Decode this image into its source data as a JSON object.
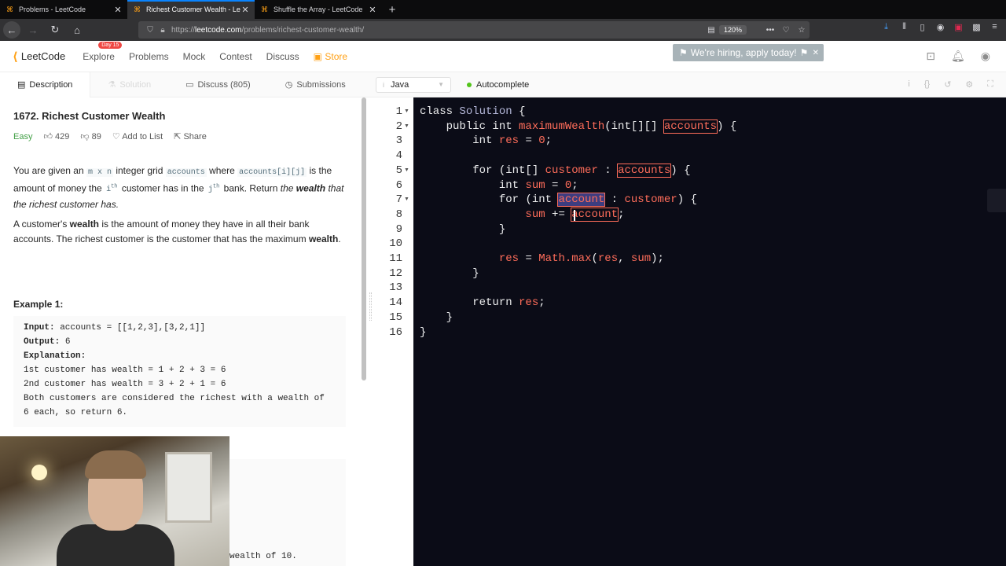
{
  "browser": {
    "tabs": [
      {
        "title": "Problems - LeetCode",
        "active": false
      },
      {
        "title": "Richest Customer Wealth - Lee",
        "active": true
      },
      {
        "title": "Shuffle the Array - LeetCode",
        "active": false
      }
    ],
    "url_prefix": "https://",
    "url_domain": "leetcode.com",
    "url_path": "/problems/richest-customer-wealth/",
    "zoom": "120%"
  },
  "lcnav": {
    "logo": "LeetCode",
    "items": [
      "Explore",
      "Problems",
      "Mock",
      "Contest",
      "Discuss"
    ],
    "explore_badge": "Day 15",
    "store": "Store",
    "hiring": "We're hiring, apply today!"
  },
  "left_tabs": {
    "description": "Description",
    "solution": "Solution",
    "discuss": "Discuss (805)",
    "submissions": "Submissions"
  },
  "problem": {
    "title": "1672. Richest Customer Wealth",
    "difficulty": "Easy",
    "likes": "429",
    "dislikes": "89",
    "add_to_list": "Add to List",
    "share": "Share",
    "p1_a": "You are given an",
    "p1_code1": "m x n",
    "p1_b": "integer grid",
    "p1_code2": "accounts",
    "p1_c": "where",
    "p1_code3": "accounts[i][j]",
    "p1_d": "is the amount of money the",
    "p1_i": "i",
    "p1_th1": "th",
    "p1_e": "customer has in the",
    "p1_j": "j",
    "p1_th2": "th",
    "p1_f": "bank. Return",
    "p1_g": "the",
    "p1_h_bold": "wealth",
    "p1_h": "that the richest customer has.",
    "p2_a": "A customer's",
    "p2_bold": "wealth",
    "p2_b": "is the amount of money they have in all their bank accounts. The richest customer is the customer that has the maximum",
    "p2_bold2": "wealth",
    "p2_c": ".",
    "example_title": "Example 1:",
    "example_lines": [
      {
        "label": "Input:",
        "text": " accounts = [[1,2,3],[3,2,1]]"
      },
      {
        "label": "Output:",
        "text": " 6"
      },
      {
        "label": "Explanation:",
        "text": ""
      },
      {
        "label": "",
        "text": "1st customer has wealth = 1 + 2 + 3 = 6"
      },
      {
        "label": "",
        "text": "2nd customer has wealth = 3 + 2 + 1 = 6"
      },
      {
        "label": "",
        "text": "Both customers are considered the richest with a wealth of"
      },
      {
        "label": "",
        "text": "6 each, so return 6."
      }
    ],
    "example2_tail": "wealth of 10."
  },
  "editor_toolbar": {
    "language": "Java",
    "autocomplete": "Autocomplete"
  },
  "code": {
    "line_numbers": [
      "1",
      "2",
      "3",
      "4",
      "5",
      "6",
      "7",
      "8",
      "9",
      "10",
      "11",
      "12",
      "13",
      "14",
      "15",
      "16"
    ],
    "l1_kw": "class",
    "l1_cls": "Solution",
    "l1_end": " {",
    "l2_ind": "    ",
    "l2_kw": "public int ",
    "l2_fn": "maximumWealth",
    "l2_mid": "(int[][] ",
    "l2_arg": "accounts",
    "l2_end": ") {",
    "l3_ind": "        ",
    "l3_kw": "int ",
    "l3_var": "res",
    "l3_mid": " = ",
    "l3_num": "0",
    "l3_end": ";",
    "l5_ind": "        ",
    "l5_kw": "for ",
    "l5_a": "(int[] ",
    "l5_var": "customer",
    "l5_b": " : ",
    "l5_arg": "accounts",
    "l5_end": ") {",
    "l6_ind": "            ",
    "l6_kw": "int ",
    "l6_var": "sum",
    "l6_mid": " = ",
    "l6_num": "0",
    "l6_end": ";",
    "l7_ind": "            ",
    "l7_kw": "for ",
    "l7_a": "(int ",
    "l7_var": "account",
    "l7_b": " : ",
    "l7_c": "customer",
    "l7_end": ") {",
    "l8_ind": "                ",
    "l8_var": "sum",
    "l8_mid": " += ",
    "l8_arg": "account",
    "l8_end": ";",
    "l9_ind": "            ",
    "l9_end": "}",
    "l11_ind": "            ",
    "l11_var": "res",
    "l11_mid": " = ",
    "l11_fn": "Math.max",
    "l11_a": "(",
    "l11_v1": "res",
    "l11_b": ", ",
    "l11_v2": "sum",
    "l11_end": ");",
    "l12_ind": "        ",
    "l12_end": "}",
    "l14_ind": "        ",
    "l14_kw": "return ",
    "l14_var": "res",
    "l14_end": ";",
    "l15_ind": "    ",
    "l15_end": "}",
    "l16_end": "}"
  },
  "colors": {
    "accent": "#ffa116",
    "editor_bg": "#0b0c17",
    "keyword": "#ecedee",
    "identifier": "#ff6d5a",
    "class_name": "#b4b7d8",
    "easy": "#43a047"
  }
}
